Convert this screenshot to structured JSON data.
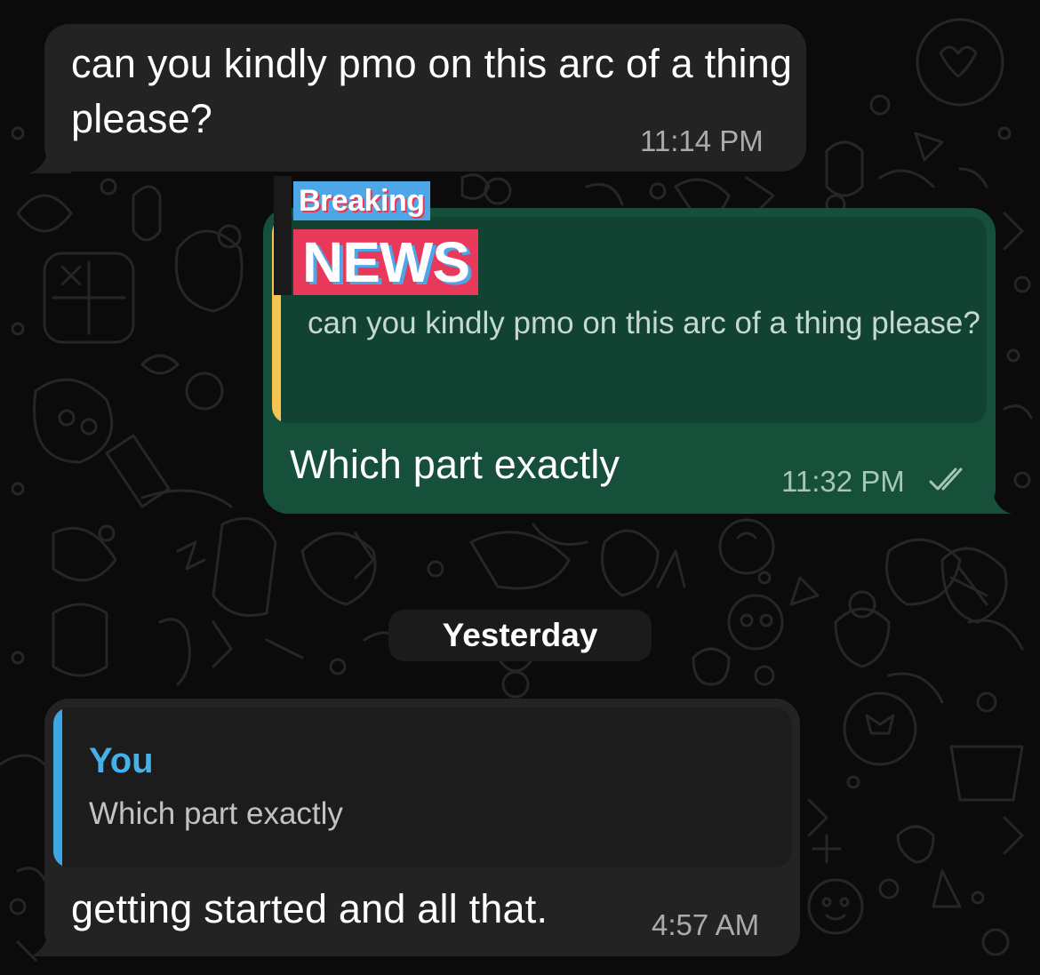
{
  "theme": {
    "background": "#0b0b0b",
    "incoming_bubble": "#232323",
    "outgoing_bubble": "#16503a",
    "quote_outgoing_bg": "#124232",
    "quote_outgoing_bar": "#f5c451",
    "quote_incoming_bg": "#1c1c1c",
    "quote_incoming_bar": "#3ea6e0",
    "quote_author_color": "#45b0ea",
    "read_receipt_color": "#a7c6b8"
  },
  "messages": [
    {
      "direction": "incoming",
      "text": "can you kindly pmo on this arc of a thing please?",
      "time": "11:14 PM"
    },
    {
      "direction": "outgoing",
      "sticker": {
        "top": "Breaking",
        "bottom": "NEWS"
      },
      "quote": {
        "text": "can you kindly pmo on this arc of a thing please?"
      },
      "text": "Which part exactly",
      "time": "11:32 PM",
      "status_icon": "double-check-icon"
    },
    {
      "direction": "incoming",
      "quote": {
        "author": "You",
        "text": "Which part exactly"
      },
      "text": "getting started and all that.",
      "time": "4:57 AM"
    }
  ],
  "date_separator": "Yesterday"
}
